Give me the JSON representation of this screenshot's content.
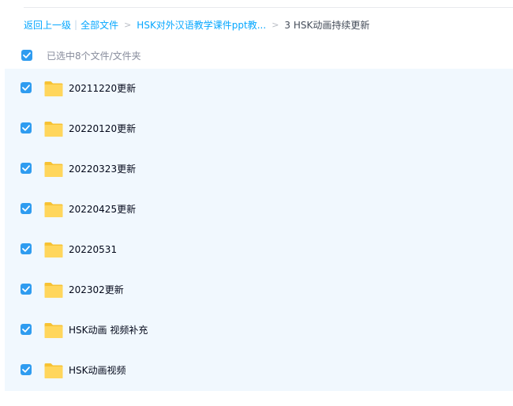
{
  "breadcrumb": {
    "back": "返回上一级",
    "all_files": "全部文件",
    "parent": "HSK对外汉语教学课件ppt教...",
    "current": "3 HSK动画持续更新",
    "separator": ">",
    "bar": "|"
  },
  "selection": {
    "text": "已选中8个文件/文件夹",
    "all_checked": true
  },
  "files": [
    {
      "name": "20211220更新",
      "type": "folder-icon",
      "checked": true
    },
    {
      "name": "20220120更新",
      "type": "folder-icon",
      "checked": true
    },
    {
      "name": "20220323更新",
      "type": "folder-icon",
      "checked": true
    },
    {
      "name": "20220425更新",
      "type": "folder-icon",
      "checked": true
    },
    {
      "name": "20220531",
      "type": "folder-icon",
      "checked": true
    },
    {
      "name": "202302更新",
      "type": "folder-icon",
      "checked": true
    },
    {
      "name": "HSK动画 视频补充",
      "type": "folder-icon",
      "checked": true
    },
    {
      "name": "HSK动画视频",
      "type": "folder-icon",
      "checked": true
    }
  ],
  "colors": {
    "link": "#06a7ff",
    "checkbox": "#2f9cf0",
    "selected_row_bg": "#f1f8fe",
    "folder_back": "#f7c233",
    "folder_front": "#ffd65c"
  }
}
